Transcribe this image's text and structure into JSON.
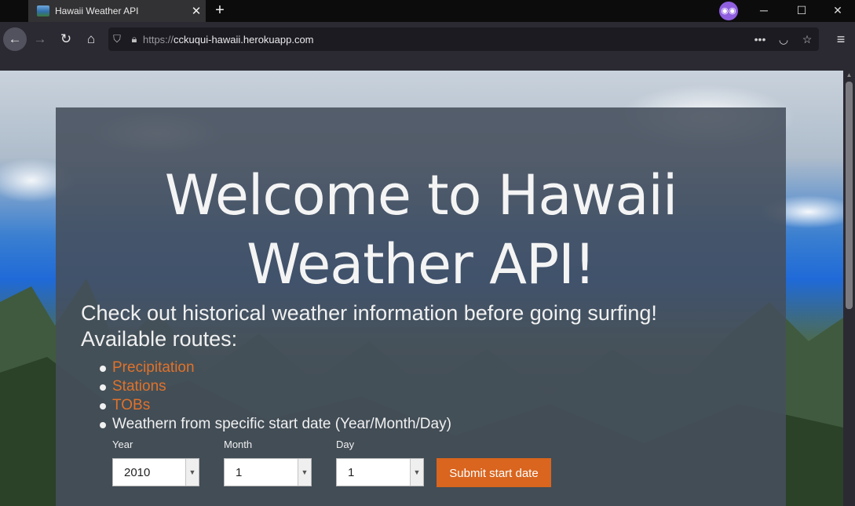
{
  "browser": {
    "tab_title": "Hawaii Weather API",
    "url_prefix": "https://",
    "url_host": "cckuqui-hawaii.herokuapp.com"
  },
  "page": {
    "heading": "Welcome to Hawaii Weather API!",
    "intro_line1": "Check out historical weather information before going surfing!",
    "intro_line2": "Available routes:",
    "routes": [
      {
        "label": "Precipitation",
        "link": true
      },
      {
        "label": "Stations",
        "link": true
      },
      {
        "label": "TOBs",
        "link": true
      },
      {
        "label": "Weathern from specific start date (Year/Month/Day)",
        "link": false
      }
    ],
    "form": {
      "year_label": "Year",
      "year_value": "2010",
      "month_label": "Month",
      "month_value": "1",
      "day_label": "Day",
      "day_value": "1",
      "submit_label": "Submit start date"
    }
  },
  "colors": {
    "link": "#e0722a",
    "button": "#d9651f",
    "card": "rgba(70,79,92,0.88)"
  }
}
